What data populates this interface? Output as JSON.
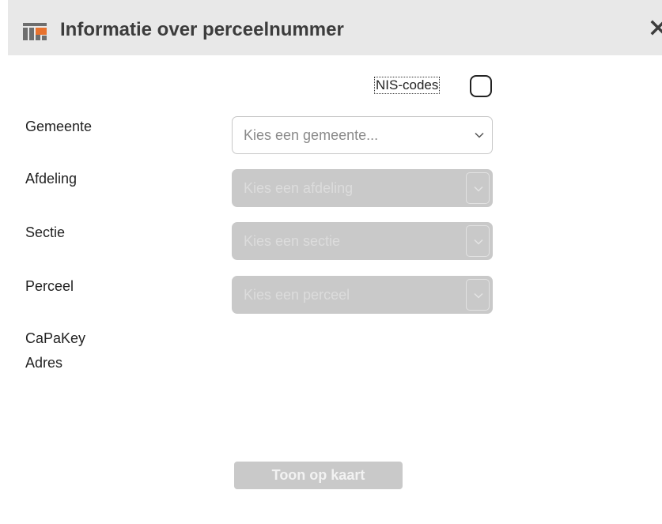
{
  "header": {
    "title": "Informatie over perceelnummer",
    "icon": "map-grid-icon",
    "close_icon": "close-icon"
  },
  "nis_codes": {
    "label": "NIS-codes",
    "checked": false
  },
  "fields": [
    {
      "label": "Gemeente",
      "placeholder": "Kies een gemeente...",
      "enabled": true
    },
    {
      "label": "Afdeling",
      "placeholder": "Kies een afdeling",
      "enabled": false
    },
    {
      "label": "Sectie",
      "placeholder": "Kies een sectie",
      "enabled": false
    },
    {
      "label": "Perceel",
      "placeholder": "Kies een perceel",
      "enabled": false
    }
  ],
  "info": {
    "capakey_label": "CaPaKey",
    "adres_label": "Adres"
  },
  "actions": {
    "show_on_map_label": "Toon op kaart",
    "show_on_map_enabled": false
  },
  "colors": {
    "header_bg": "#e8e8e8",
    "icon_accent": "#e8722e",
    "icon_grey": "#6e6e6e",
    "disabled_bg": "#c9c9c9"
  }
}
